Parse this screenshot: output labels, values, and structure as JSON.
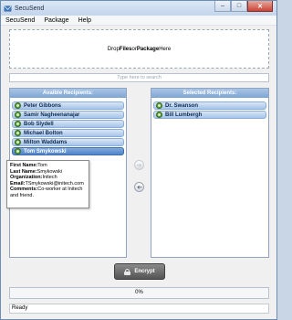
{
  "window": {
    "title": "SecuSend"
  },
  "menu": [
    "SecuSend",
    "Package",
    "Help"
  ],
  "dropzone": {
    "prefix": "Drop ",
    "files": "Files",
    "middle": " or ",
    "package": "Package",
    "suffix": " Here"
  },
  "search": {
    "placeholder": "Type here to search"
  },
  "available": {
    "header": "Avaible Recipients:",
    "items": [
      {
        "label": "Peter Gibbons",
        "selected": false
      },
      {
        "label": "Samir Nagheenanajar",
        "selected": false
      },
      {
        "label": "Bob Slydell",
        "selected": false
      },
      {
        "label": "Michael Bolton",
        "selected": false
      },
      {
        "label": "Milton Waddams",
        "selected": false
      },
      {
        "label": "Tom Smykowski",
        "selected": true
      }
    ]
  },
  "selected": {
    "header": "Selected Recipients:",
    "items": [
      {
        "label": "Dr. Swanson",
        "selected": false
      },
      {
        "label": "Bill Lumbergh",
        "selected": false
      }
    ]
  },
  "tooltip": {
    "first_name_label": "First Name:",
    "first_name": "Tom",
    "last_name_label": "Last Name:",
    "last_name": "Smykowski",
    "org_label": "Organization:",
    "org": "Initech",
    "email_label": "Email:",
    "email": "TSmykowski@initech.com",
    "comments_label": "Comments:",
    "comments": "Co-worker at Initech and friend."
  },
  "encrypt_label": "Encrypt",
  "progress": {
    "value": 0,
    "text": "0%"
  },
  "status": "Ready",
  "icons": {
    "move_right": "arrow-right-icon",
    "move_left": "arrow-left-icon",
    "encrypt": "lock-icon",
    "recipient": "user-icon"
  },
  "colors": {
    "panel_header": "#7ea5d3",
    "selected_row": "#4f83c6",
    "encrypt_button": "#545454"
  }
}
